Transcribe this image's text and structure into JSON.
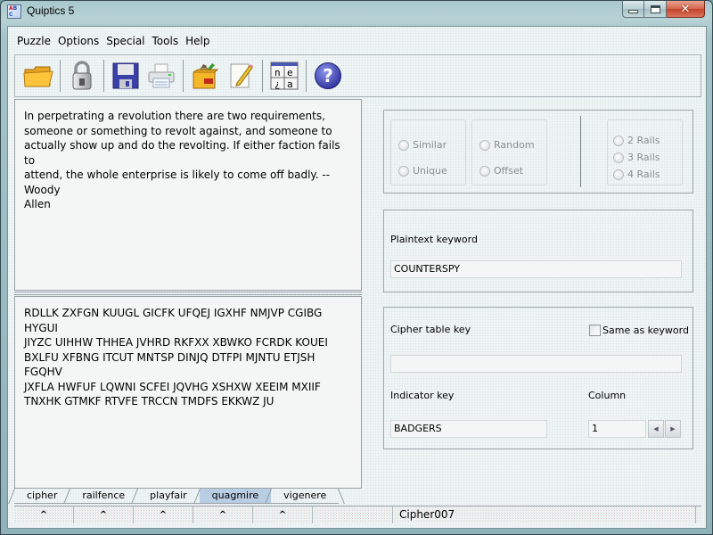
{
  "window": {
    "title": "Quiptics 5",
    "controls": {
      "minimize": "minimize",
      "maximize": "maximize",
      "close": "close"
    }
  },
  "menu": [
    "Puzzle",
    "Options",
    "Special",
    "Tools",
    "Help"
  ],
  "toolbar": {
    "buttons": [
      {
        "name": "open",
        "icon": "folder-icon"
      },
      {
        "name": "lock",
        "icon": "padlock-icon"
      },
      {
        "name": "save",
        "icon": "floppy-disk-icon"
      },
      {
        "name": "print",
        "icon": "printer-icon"
      },
      {
        "name": "tools",
        "icon": "toolbox-icon"
      },
      {
        "name": "notes",
        "icon": "notepad-pencil-icon"
      },
      {
        "name": "alphabet",
        "icon": "letter-grid-icon",
        "letters": [
          "n",
          "e",
          "¿",
          "a"
        ]
      },
      {
        "name": "help",
        "icon": "help-icon"
      }
    ]
  },
  "plaintext": "In perpetrating a revolution there are two requirements,\nsomeone or something to revolt against, and someone to\nactually show up and do the revolting. If either faction fails to\nattend, the whole enterprise is likely to come off badly. --Woody\nAllen",
  "ciphertext": "RDLLK ZXFGN KUUGL GICFK UFQEJ IGXHF NMJVP CGIBG HYGUI\nJIYZC UIHHW THHEA JVHRD RKFXX XBWKO FCRDK KOUEI\nBXLFU XFBNG ITCUT MNTSP DINJQ DTFPI MJNTU ETJSH FGQHV\nJXFLA HWFUF LQWNI SCFEI JQVHG XSHXW XEEIM MXIIF\nTNXHK GTMKF RTVFE TRCCN TMDFS EKKWZ JU",
  "tabs": [
    {
      "label": "cipher",
      "active": false
    },
    {
      "label": "railfence",
      "active": false
    },
    {
      "label": "playfair",
      "active": false
    },
    {
      "label": "quagmire",
      "active": true
    },
    {
      "label": "vigenere",
      "active": false
    }
  ],
  "statusbar": {
    "arrows": [
      "^",
      "^",
      "^",
      "^",
      "^"
    ],
    "puzzle_name": "Cipher007"
  },
  "options": {
    "group1": [
      "Similar",
      "Unique"
    ],
    "group2": [
      "Random",
      "Offset"
    ],
    "rails": [
      "2 Rails",
      "3 Rails",
      "4 Rails"
    ]
  },
  "plaintext_keyword": {
    "label": "Plaintext keyword",
    "value": "COUNTERSPY"
  },
  "cipher_table": {
    "label": "Cipher table key",
    "value": "",
    "same_as_keyword_label": "Same as keyword",
    "same_as_keyword_checked": false
  },
  "indicator": {
    "label": "Indicator key",
    "value": "BADGERS"
  },
  "column": {
    "label": "Column",
    "value": "1"
  }
}
